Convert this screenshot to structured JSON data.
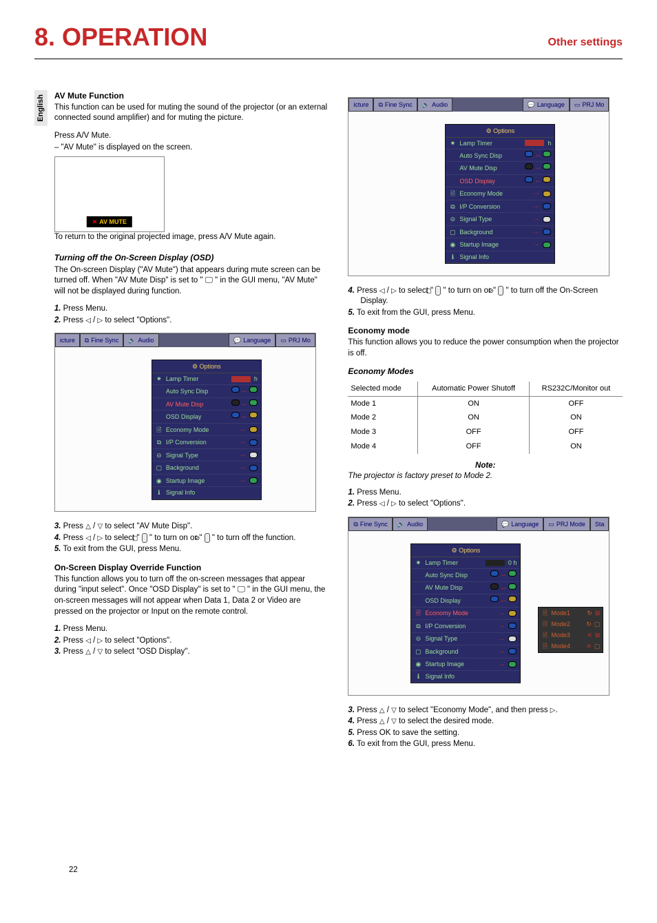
{
  "header": {
    "chapter": "8. OPERATION",
    "subtitle": "Other settings"
  },
  "lang_tab": "English",
  "left": {
    "avmute": {
      "heading": "AV Mute Function",
      "body": "This function can be used for muting the sound of the projector (or an external connected sound amplifier) and for muting the picture.",
      "press": "Press A/V Mute.",
      "dash": "– \"AV Mute\" is displayed on the screen.",
      "badge": "AV MUTE",
      "return": "To return to the original projected image, press A/V Mute again."
    },
    "turnoff": {
      "heading": "Turning off the On-Screen Display (OSD)",
      "body": "The On-screen Display (\"AV Mute\") that appears during mute screen can be turned off. When \"AV Mute Disp\" is set to \" 🖵 \" in the GUI menu, \"AV Mute\" will not be displayed during function.",
      "s1": "Press Menu.",
      "s2_a": "Press ",
      "s2_b": " / ",
      "s2_c": " to select \"Options\"."
    },
    "after_first_osd": {
      "s3_a": "Press ",
      "s3_b": " / ",
      "s3_c": " to select \"AV Mute Disp\".",
      "s4_a": "Press ",
      "s4_b": " / ",
      "s4_c": " to select \" ",
      "s4_d": " \" to turn on or \" ",
      "s4_e": " \" to turn off the function.",
      "s5": "To exit from the GUI, press Menu."
    },
    "override": {
      "heading": "On-Screen Display Override Function",
      "body": "This function allows you to turn off the on-screen messages that appear during \"input select\". Once \"OSD Display\" is set to \" 🖵 \" in the GUI menu, the on-screen messages will not appear when Data 1, Data 2 or Video are pressed on the projector or Input on the remote control.",
      "s1": "Press Menu.",
      "s2_a": "Press ",
      "s2_b": " / ",
      "s2_c": " to select \"Options\".",
      "s3_a": "Press ",
      "s3_b": " / ",
      "s3_c": " to select \"OSD Display\"."
    }
  },
  "right": {
    "top_steps": {
      "s4_a": "Press ",
      "s4_b": " / ",
      "s4_c": " to select \" ",
      "s4_d": " \" to turn on or \" ",
      "s4_e": " \" to turn off the On-Screen Display.",
      "s5": "To exit from the GUI, press Menu."
    },
    "economy": {
      "heading": "Economy mode",
      "body": "This function allows you to reduce the power consumption when the projector is off.",
      "modes_heading": "Economy Modes",
      "note_label": "Note:",
      "note_body": "The projector is factory preset to Mode 2.",
      "s1": "Press Menu.",
      "s2_a": "Press ",
      "s2_b": " / ",
      "s2_c": " to select \"Options\"."
    },
    "bottom_steps": {
      "s3_a": "Press ",
      "s3_b": " / ",
      "s3_c": " to select \"Economy Mode\", and then press ",
      "s4_a": "Press ",
      "s4_b": " / ",
      "s4_c": " to select the desired mode.",
      "s5": "Press OK to save the setting.",
      "s6": "To exit from the GUI, press Menu."
    }
  },
  "osd_menus": {
    "first": {
      "tabs": [
        "icture",
        "Fine Sync",
        "Audio",
        "Language",
        "PRJ Mo"
      ],
      "title": "Options",
      "rows": [
        {
          "label": "Lamp Timer",
          "hl": false,
          "bar": true,
          "suffix": "h"
        },
        {
          "label": "Auto Sync Disp",
          "hl": false
        },
        {
          "label": "AV Mute Disp",
          "hl": true
        },
        {
          "label": "OSD Display",
          "hl": false
        },
        {
          "label": "Economy Mode",
          "hl": false,
          "arw": true
        },
        {
          "label": "I/P Conversion",
          "hl": false,
          "arw": true
        },
        {
          "label": "Signal Type",
          "hl": false,
          "arw": true
        },
        {
          "label": "Background",
          "hl": false,
          "arw": true
        },
        {
          "label": "Startup Image",
          "hl": false,
          "arw": true
        },
        {
          "label": "Signal Info",
          "hl": false
        }
      ]
    },
    "second": {
      "tabs": [
        "icture",
        "Fine Sync",
        "Audio",
        "Language",
        "PRJ Mo"
      ],
      "title": "Options",
      "hl_row": "OSD Display"
    },
    "third": {
      "tabs": [
        "Fine Sync",
        "Audio",
        "Language",
        "PRJ Mode",
        "Sta"
      ],
      "title": "Options",
      "hl_row": "Economy Mode",
      "modes": [
        "Mode1",
        "Mode2",
        "Mode3",
        "Mode4"
      ]
    }
  },
  "chart_data": {
    "type": "table",
    "title": "Economy Modes",
    "columns": [
      "Selected mode",
      "Automatic Power Shutoff",
      "RS232C/Monitor out"
    ],
    "rows": [
      {
        "mode": "Mode 1",
        "auto": "ON",
        "rs": "OFF"
      },
      {
        "mode": "Mode 2",
        "auto": "ON",
        "rs": "ON"
      },
      {
        "mode": "Mode 3",
        "auto": "OFF",
        "rs": "OFF"
      },
      {
        "mode": "Mode 4",
        "auto": "OFF",
        "rs": "ON"
      }
    ]
  },
  "page_number": "22"
}
